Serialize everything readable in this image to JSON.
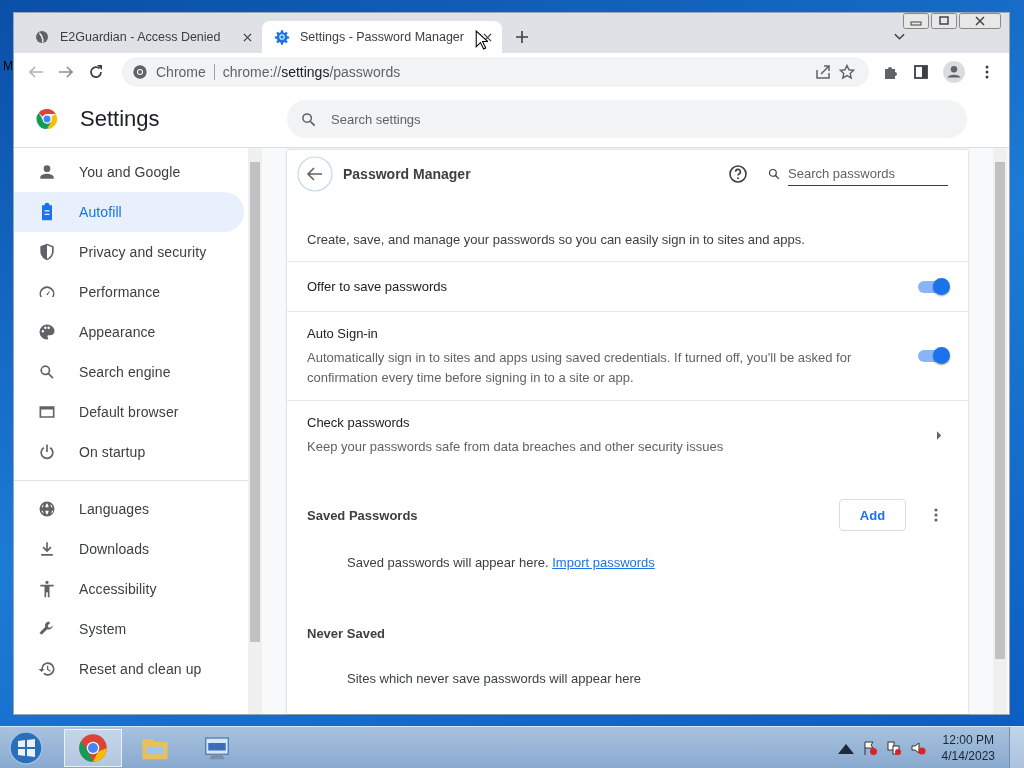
{
  "desktop": {
    "edge_text": "M"
  },
  "tabs": [
    {
      "title": "E2Guardian - Access Denied",
      "selected": false
    },
    {
      "title": "Settings - Password Manager",
      "selected": true
    }
  ],
  "address_bar": {
    "site_chip": "Chrome",
    "url": "chrome://**settings**/passwords"
  },
  "settings_header": {
    "title": "Settings",
    "search_placeholder": "Search settings"
  },
  "sidebar": {
    "groups": [
      [
        {
          "label": "You and Google",
          "selected": false
        },
        {
          "label": "Autofill",
          "selected": true
        },
        {
          "label": "Privacy and security",
          "selected": false
        },
        {
          "label": "Performance",
          "selected": false
        },
        {
          "label": "Appearance",
          "selected": false
        },
        {
          "label": "Search engine",
          "selected": false
        },
        {
          "label": "Default browser",
          "selected": false
        },
        {
          "label": "On startup",
          "selected": false
        }
      ],
      [
        {
          "label": "Languages",
          "selected": false
        },
        {
          "label": "Downloads",
          "selected": false
        },
        {
          "label": "Accessibility",
          "selected": false
        },
        {
          "label": "System",
          "selected": false
        },
        {
          "label": "Reset and clean up",
          "selected": false
        }
      ]
    ]
  },
  "page": {
    "title": "Password Manager",
    "search_placeholder": "Search passwords",
    "description": "Create, save, and manage your passwords so you can easily sign in to sites and apps.",
    "rows": [
      {
        "kind": "toggle",
        "title": "Offer to save passwords",
        "on": true
      },
      {
        "kind": "toggle",
        "title": "Auto Sign-in",
        "subtitle": "Automatically sign in to sites and apps using saved credentials. If turned off, you'll be asked for confirmation every time before signing in to a site or app.",
        "on": true
      },
      {
        "kind": "link",
        "title": "Check passwords",
        "subtitle": "Keep your passwords safe from data breaches and other security issues"
      }
    ],
    "saved": {
      "title": "Saved Passwords",
      "add_button": "Add",
      "empty_text": "Saved passwords will appear here.",
      "import_link": "Import passwords"
    },
    "never_saved": {
      "title": "Never Saved",
      "empty_text": "Sites which never save passwords will appear here"
    }
  },
  "taskbar": {
    "time": "12:00 PM",
    "date": "4/14/2023"
  }
}
